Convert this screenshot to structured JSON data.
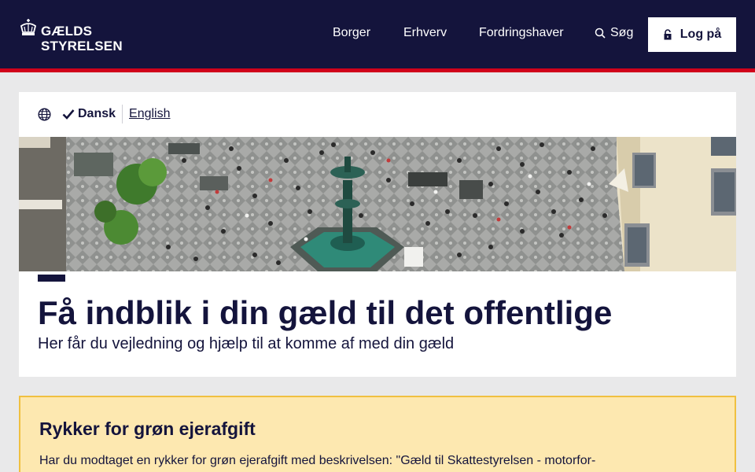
{
  "brand": {
    "line1": "GÆLDS",
    "line2": "STYRELSEN",
    "header_bg": "#14143c",
    "accent_red": "#d0021b"
  },
  "nav": {
    "items": [
      {
        "label": "Borger"
      },
      {
        "label": "Erhverv"
      },
      {
        "label": "Fordringshaver"
      }
    ],
    "search_label": "Søg",
    "login_label": "Log på"
  },
  "language": {
    "current": "Dansk",
    "alternate": "English"
  },
  "hero": {
    "title": "Få indblik i din gæld til det offentlige",
    "subtitle": "Her får du vejledning og hjælp til at komme af med din gæld"
  },
  "notice": {
    "title": "Rykker for grøn ejerafgift",
    "body": "Har du modtaget en rykker for grøn ejerafgift med beskrivelsen: \"Gæld til Skattestyrelsen - motorfor-",
    "bg": "#fde8b0",
    "border": "#f0c040"
  },
  "icons": {
    "logo": "crown-icon",
    "search": "search-icon",
    "login": "lock-icon",
    "language": "globe-icon",
    "selected": "check-icon"
  }
}
